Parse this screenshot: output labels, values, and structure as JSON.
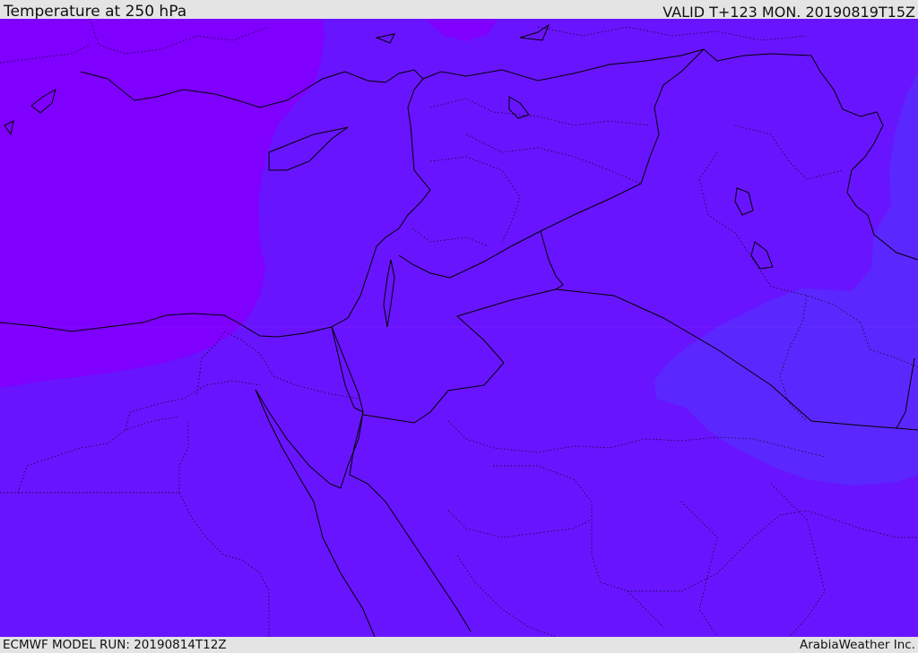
{
  "header": {
    "title": "Temperature at 250 hPa",
    "valid_time": "VALID T+123 MON. 20190819T15Z"
  },
  "footer": {
    "model_run": "ECMWF MODEL RUN: 20190814T12Z",
    "credit": "ArabiaWeather Inc."
  },
  "map": {
    "field": "Temperature",
    "level": "250 hPa",
    "colors": {
      "coldest": "#7f00ff",
      "mid": "#6914ff",
      "warmer": "#5a28ff",
      "coastline": "#000000",
      "border": "#000000"
    }
  }
}
